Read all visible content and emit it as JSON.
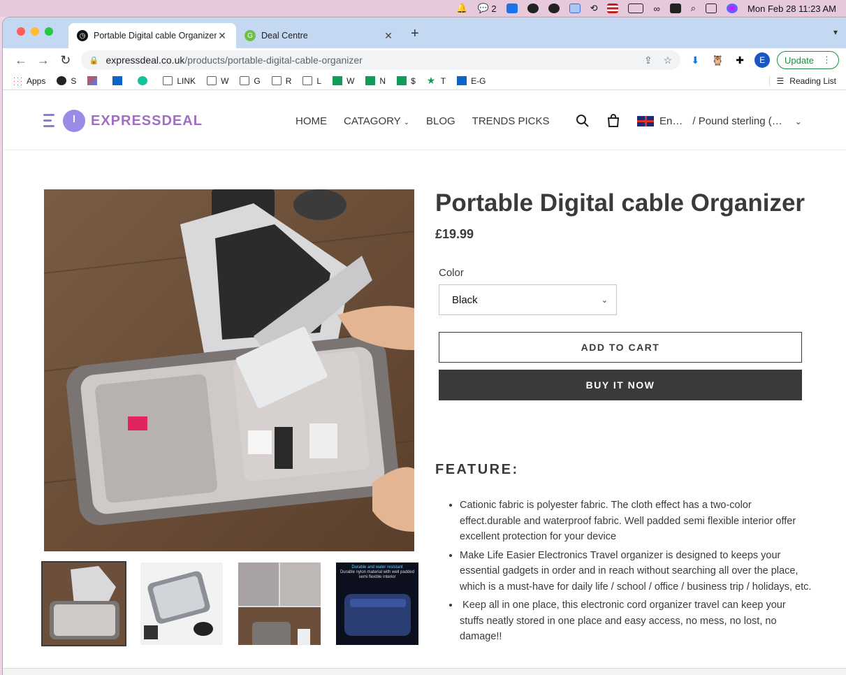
{
  "menubar": {
    "wechat_count": "2",
    "datetime": "Mon Feb 28  11:23 AM"
  },
  "browser": {
    "tabs": [
      {
        "title": "Portable Digital cable Organizer",
        "active": true
      },
      {
        "title": "Deal Centre",
        "active": false
      }
    ],
    "url_host": "expressdeal.co.uk",
    "url_path": "/products/portable-digital-cable-organizer",
    "profile_initial": "E",
    "update_label": "Update",
    "bookmarks": [
      {
        "label": "Apps",
        "icon": "apps-grid-icon"
      },
      {
        "label": "S",
        "icon": "globe-icon"
      },
      {
        "label": "",
        "icon": "gmail-icon"
      },
      {
        "label": "",
        "icon": "outlook-icon"
      },
      {
        "label": "",
        "icon": "grammarly-icon"
      },
      {
        "label": "LINK",
        "icon": "folder-icon"
      },
      {
        "label": "W",
        "icon": "folder-icon"
      },
      {
        "label": "G",
        "icon": "folder-icon"
      },
      {
        "label": "R",
        "icon": "folder-icon"
      },
      {
        "label": "L",
        "icon": "folder-icon"
      },
      {
        "label": "W",
        "icon": "sheets-icon"
      },
      {
        "label": "N",
        "icon": "sheets-icon"
      },
      {
        "label": "$",
        "icon": "sheets-icon"
      },
      {
        "label": "T",
        "icon": "star-icon"
      },
      {
        "label": "E-G",
        "icon": "outlook-icon"
      }
    ],
    "reading_list": "Reading List"
  },
  "site": {
    "logo_text": "EXPRESSDEAL",
    "nav": [
      "HOME",
      "CATAGORY",
      "BLOG",
      "TRENDS PICKS"
    ],
    "language": "En…",
    "currency": "/ Pound sterling (…"
  },
  "product": {
    "title": "Portable Digital cable Organizer",
    "price": "£19.99",
    "option_label": "Color",
    "option_value": "Black",
    "add_to_cart": "ADD TO CART",
    "buy_now": "BUY IT NOW",
    "feature_heading": "FEATURE:",
    "features": [
      "Cationic fabric is polyester fabric. The cloth effect has a two-color effect.durable and waterproof fabric. Well padded semi flexible interior offer excellent protection for your device",
      "Make Life Easier Electronics Travel organizer is designed to keeps your essential gadgets in order and in reach without searching all over the place, which is a must-have for daily life / school / office / business trip / holidays, etc.",
      " Keep all in one place, this electronic cord organizer travel can keep your stuffs neatly stored in one place and easy access, no mess, no lost, no damage!!"
    ],
    "thumb4_caption_1": "Durable and water resistant",
    "thumb4_caption_2": "Durable nylon material with well padded semi flexible interior"
  },
  "colors": {
    "accent_purple": "#a06fc4",
    "text_dark": "#3a3a3a",
    "update_green": "#1e8e3e"
  }
}
